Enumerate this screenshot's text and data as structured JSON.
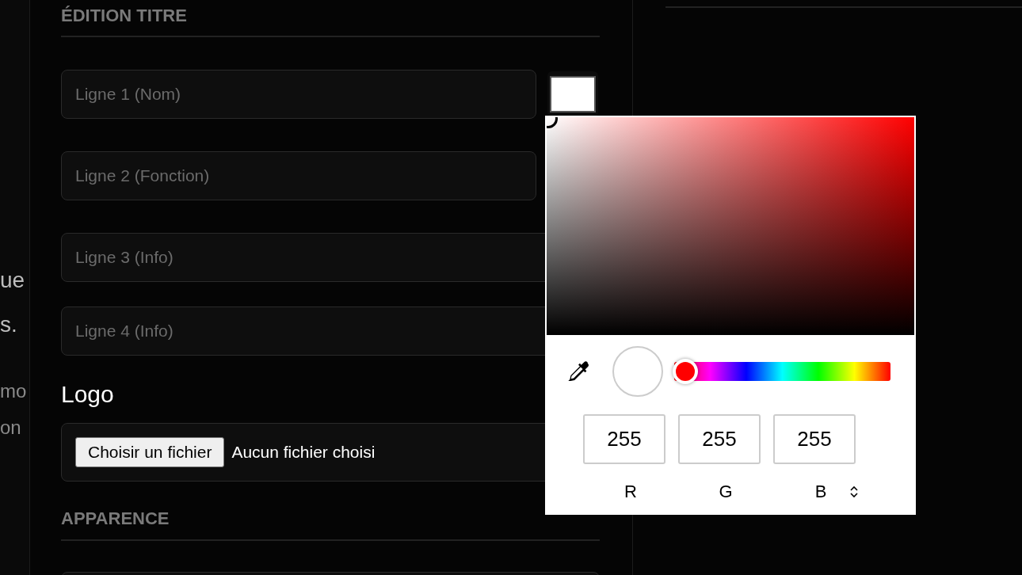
{
  "left_fragments": [
    {
      "text": "ue",
      "kind": "large"
    },
    {
      "text": "s.",
      "kind": "large"
    },
    {
      "text": "mo",
      "kind": "small"
    },
    {
      "text": "on",
      "kind": "small"
    }
  ],
  "title_section": {
    "heading": "ÉDITION TITRE",
    "fields": [
      {
        "placeholder": "Ligne 1 (Nom)",
        "swatch": true
      },
      {
        "placeholder": "Ligne 2 (Fonction)",
        "swatch": false
      },
      {
        "placeholder": "Ligne 3 (Info)",
        "swatch": false
      },
      {
        "placeholder": "Ligne 4 (Info)",
        "swatch": false
      }
    ]
  },
  "logo": {
    "heading": "Logo",
    "button": "Choisir un fichier",
    "status": "Aucun fichier choisi"
  },
  "appearance": {
    "heading": "APPARENCE"
  },
  "color_picker": {
    "hue": {
      "level": 0
    },
    "channels": [
      {
        "value": "255",
        "label": "R"
      },
      {
        "value": "255",
        "label": "G"
      },
      {
        "value": "255",
        "label": "B"
      }
    ]
  }
}
